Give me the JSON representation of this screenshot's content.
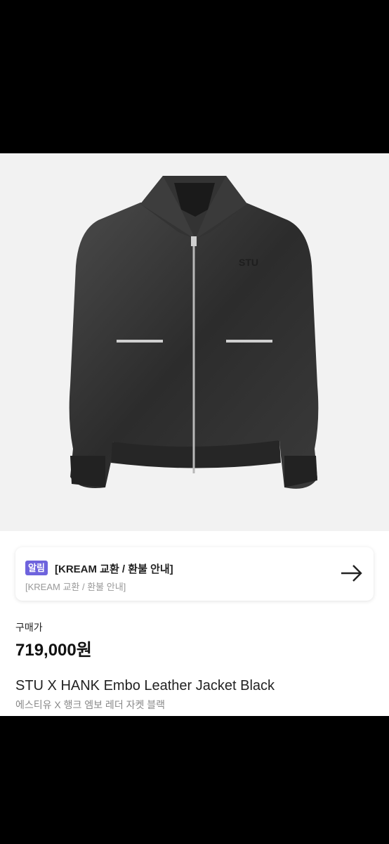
{
  "notice": {
    "badge": "알림",
    "title": "[KREAM 교환 / 환불 안내]",
    "subtitle": "[KREAM 교환 / 환불 안내]",
    "arrow_icon": "arrow-right-icon"
  },
  "price": {
    "label": "구매가",
    "value": "719,000원"
  },
  "product": {
    "name_en": "STU X HANK Embo Leather Jacket Black",
    "name_ko": "에스티유 X 행크 엠보 레더 자켓 블랙",
    "image_icon": "leather-jacket-image"
  },
  "colors": {
    "badge": "#6e63dd",
    "image_bg": "#f2f2f2"
  }
}
